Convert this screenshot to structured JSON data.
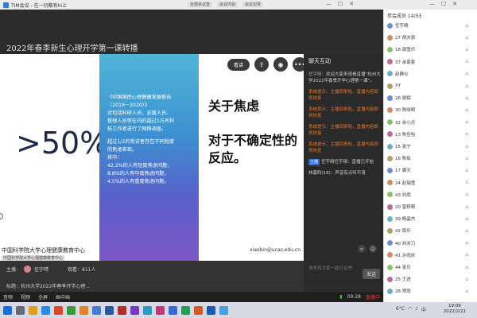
{
  "window": {
    "title": "TIM会议 - 在一切都有hi上",
    "tabs": [
      "全部会议室",
      "会议内容",
      "会议记录"
    ],
    "member_header": "参会成员 14/53"
  },
  "main": {
    "heading": "2022年春季新生心理开学第一课转播"
  },
  "slide": {
    "big_stat": ">50%",
    "grad_lines": [
      "《中国国民心理健康发展报告",
      "（2019－2020）》",
      "对包括科研人员、支援人员、",
      "管理人员等在内的超过1万名科",
      "技工作者进行了网络调查。",
      "",
      "超过1/2的受访者存在不同程度",
      "的焦虑表现。",
      "其中：",
      "42.2%的人有轻度焦虑问题，",
      "8.8%的人有中度焦虑问题，",
      "4.5%的人有重度焦虑问题。"
    ],
    "right_title1": "关于焦虑",
    "right_title2": "对于不确定性的反应。",
    "email": "xiaobin@ucas.edu.cn",
    "footer": "中国科学院大学心理健康教育中心",
    "footer2": "中国科学院大学心理健康教育中心"
  },
  "overlay": {
    "pill": "看讲",
    "more": "•••"
  },
  "chat": {
    "header": "聊天互动",
    "messages": [
      {
        "who": "任宇晴：",
        "text": "欢迎大家来观看直播“杭州大学2022年春季开学心理第一课”。",
        "sys": false
      },
      {
        "who": "系统提示：",
        "text": "主播回来啦，直播内容即将恢复",
        "sys": true
      },
      {
        "who": "系统提示：",
        "text": "主播回来啦，直播内容即将恢复",
        "sys": true
      },
      {
        "who": "系统提示：",
        "text": "主播回来啦，直播内容即将恢复",
        "sys": true
      },
      {
        "who": "系统提示：",
        "text": "主播回来啦，直播内容即将恢复",
        "sys": true
      }
    ],
    "host_tag": "主播",
    "host_msg": "任宇晴任宇晴：直播已开始",
    "audio_msg": "林鑫昀(18)：声音有点听不清",
    "input_placeholder": "快来和大家一起讨论吧",
    "send": "发送"
  },
  "info": {
    "host_label": "主播：",
    "host_name": "任宇晴",
    "views": "观看：811人",
    "title_line": "标题：杭州大学2022年春季开学心理..."
  },
  "controls": {
    "items": [
      "音频",
      "视频",
      "全屏",
      "画中画"
    ],
    "time": "09:28",
    "speed": "直播中"
  },
  "members": [
    "任宇晴",
    "27 胡夫恩",
    "18 周雪乐",
    "37 余家豪",
    "赵静仪",
    "XY",
    "26 谢斌",
    "30 陈晓明",
    "32 余小月",
    "13 陈佳怡",
    "15 张宁",
    "16 陈伯",
    "17 翼天",
    "24 赵瑞雪",
    "43 刘雨",
    "20 曾舒萌",
    "39 杨晶杰",
    "42 周乐",
    "40 刘沐刀",
    "41 许雨欣",
    "44 张贝",
    "25 王进",
    "28 郑雨"
  ],
  "taskbar": {
    "time": "19:06",
    "date": "2022/2/21",
    "temp": "6°C",
    "lang": "中"
  }
}
